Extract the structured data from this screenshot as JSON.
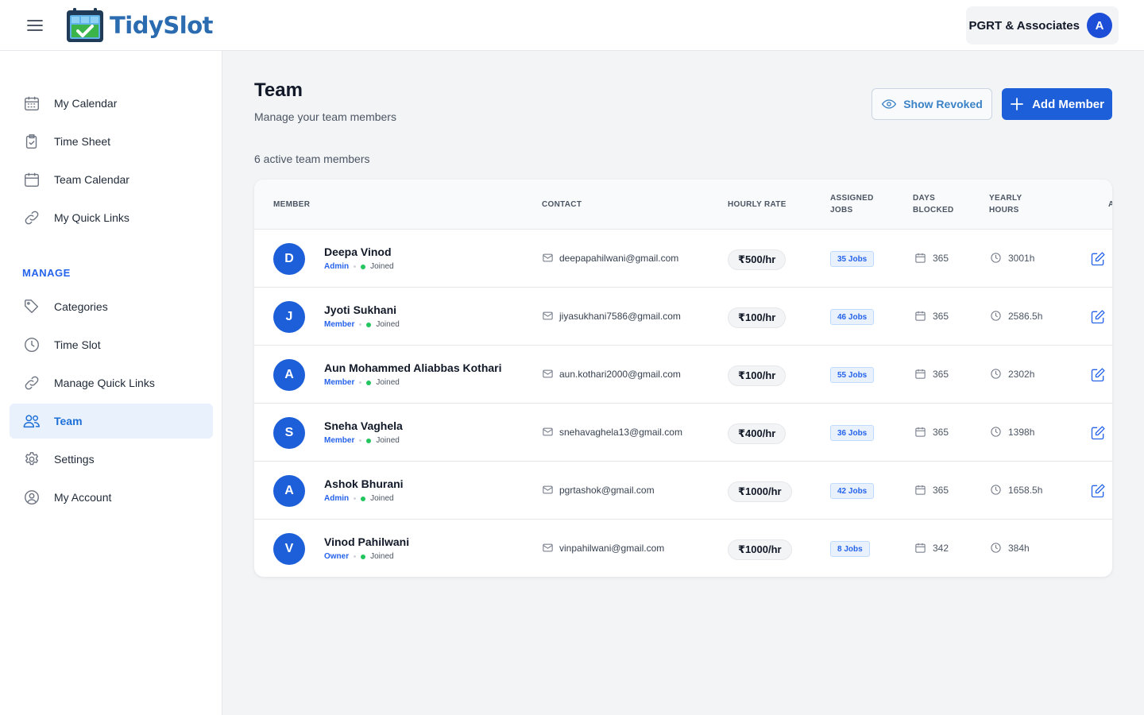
{
  "app": {
    "name": "TidySlot"
  },
  "header": {
    "org_name": "PGRT & Associates",
    "org_initial": "A"
  },
  "sidebar": {
    "items": [
      {
        "label": "My Calendar",
        "icon": "calendar-grid-icon"
      },
      {
        "label": "Time Sheet",
        "icon": "clipboard-check-icon"
      },
      {
        "label": "Team Calendar",
        "icon": "calendar-icon"
      },
      {
        "label": "My Quick Links",
        "icon": "link-icon"
      }
    ],
    "manage_title": "MANAGE",
    "manage_items": [
      {
        "label": "Categories",
        "icon": "tag-icon"
      },
      {
        "label": "Time Slot",
        "icon": "clock-icon"
      },
      {
        "label": "Manage Quick Links",
        "icon": "link-icon"
      },
      {
        "label": "Team",
        "icon": "users-icon",
        "active": true
      },
      {
        "label": "Settings",
        "icon": "gear-icon"
      },
      {
        "label": "My Account",
        "icon": "user-circle-icon"
      }
    ]
  },
  "main": {
    "title": "Team",
    "subtitle": "Manage your team members",
    "show_revoked_label": "Show Revoked",
    "add_member_label": "Add Member",
    "count_text": "6 active team members",
    "columns": {
      "member": "MEMBER",
      "contact": "CONTACT",
      "rate": "HOURLY RATE",
      "jobs_1": "ASSIGNED",
      "jobs_2": "JOBS",
      "days_1": "DAYS",
      "days_2": "BLOCKED",
      "hours_1": "YEARLY",
      "hours_2": "HOURS",
      "actions": "A"
    },
    "members": [
      {
        "initial": "D",
        "name": "Deepa Vinod",
        "role": "Admin",
        "status": "Joined",
        "email": "deepapahilwani@gmail.com",
        "rate": "₹500/hr",
        "jobs": "35 Jobs",
        "days": "365",
        "hours": "3001h",
        "editable": true
      },
      {
        "initial": "J",
        "name": "Jyoti Sukhani",
        "role": "Member",
        "status": "Joined",
        "email": "jiyasukhani7586@gmail.com",
        "rate": "₹100/hr",
        "jobs": "46 Jobs",
        "days": "365",
        "hours": "2586.5h",
        "editable": true
      },
      {
        "initial": "A",
        "name": "Aun Mohammed Aliabbas Kothari",
        "role": "Member",
        "status": "Joined",
        "email": "aun.kothari2000@gmail.com",
        "rate": "₹100/hr",
        "jobs": "55 Jobs",
        "days": "365",
        "hours": "2302h",
        "editable": true
      },
      {
        "initial": "S",
        "name": "Sneha Vaghela",
        "role": "Member",
        "status": "Joined",
        "email": "snehavaghela13@gmail.com",
        "rate": "₹400/hr",
        "jobs": "36 Jobs",
        "days": "365",
        "hours": "1398h",
        "editable": true
      },
      {
        "initial": "A",
        "name": "Ashok Bhurani",
        "role": "Admin",
        "status": "Joined",
        "email": "pgrtashok@gmail.com",
        "rate": "₹1000/hr",
        "jobs": "42 Jobs",
        "days": "365",
        "hours": "1658.5h",
        "editable": true
      },
      {
        "initial": "V",
        "name": "Vinod Pahilwani",
        "role": "Owner",
        "status": "Joined",
        "email": "vinpahilwani@gmail.com",
        "rate": "₹1000/hr",
        "jobs": "8 Jobs",
        "days": "342",
        "hours": "384h",
        "editable": false
      }
    ]
  },
  "colors": {
    "accent": "#1d5fd9",
    "sidebar_active_bg": "#e8f1fc",
    "joined_dot": "#22c55e"
  }
}
